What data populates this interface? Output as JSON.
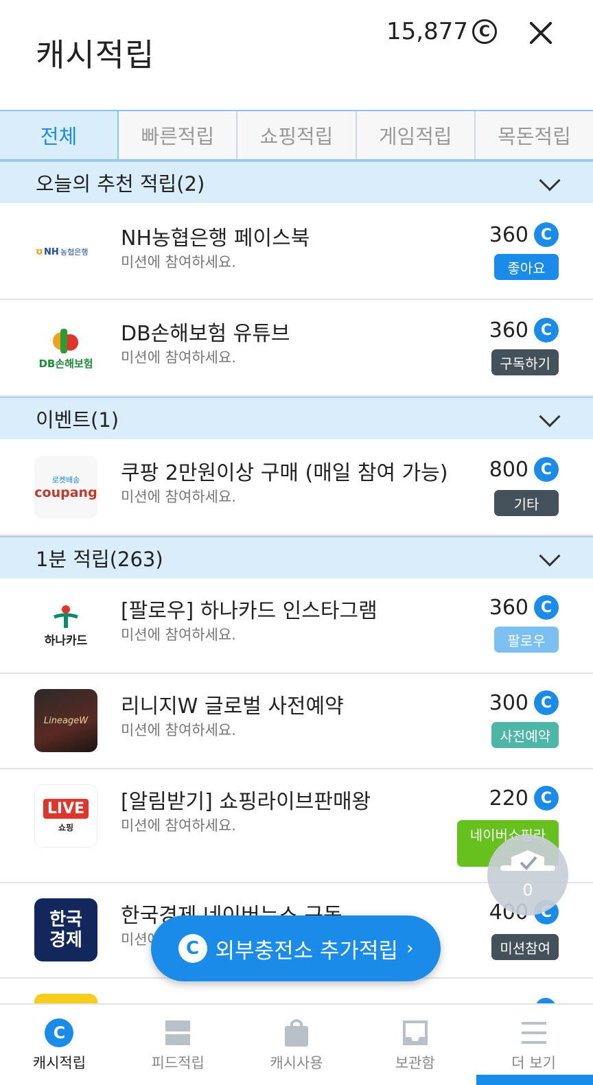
{
  "header": {
    "title": "캐시적립",
    "balance": "15,877",
    "balance_icon": "Ⓒ"
  },
  "tabs": [
    {
      "label": "전체",
      "active": true
    },
    {
      "label": "빠른적립",
      "active": false
    },
    {
      "label": "쇼핑적립",
      "active": false
    },
    {
      "label": "게임적립",
      "active": false
    },
    {
      "label": "목돈적립",
      "active": false
    }
  ],
  "sections": [
    {
      "title": "오늘의 추천 적립(2)"
    },
    {
      "title": "이벤트(1)"
    },
    {
      "title": "1분 적립(263)"
    }
  ],
  "items": [
    {
      "title": "NH농협은행 페이스북",
      "sub": "미션에 참여하세요.",
      "points": "360",
      "tag": "좋아요",
      "tag_color": "#1a8be8",
      "logo_text": "NH농협은행"
    },
    {
      "title": "DB손해보험 유튜브",
      "sub": "미션에 참여하세요.",
      "points": "360",
      "tag": "구독하기",
      "tag_color": "#44505a",
      "logo_text": "DB손해보험"
    },
    {
      "title": "쿠팡 2만원이상 구매 (매일 참여 가능)",
      "sub": "미션에 참여하세요.",
      "points": "800",
      "tag": "기타",
      "tag_color": "#44505a",
      "logo_text": "coupang",
      "logo_top": "로켓배송"
    },
    {
      "title": "[팔로우] 하나카드 인스타그램",
      "sub": "미션에 참여하세요.",
      "points": "360",
      "tag": "팔로우",
      "tag_color": "#7cc0f2",
      "logo_text": "하나카드"
    },
    {
      "title": "리니지W 글로벌  사전예약",
      "sub": "미션에 참여하세요.",
      "points": "300",
      "tag": "사전예약",
      "tag_color": "#4db6a6",
      "logo_text": "LineageW"
    },
    {
      "title": "[알림받기] 쇼핑라이브판매왕",
      "sub": "미션에 참여하세요.",
      "points": "220",
      "tag": "네이버쇼핑라",
      "tag_color": "#66c11e",
      "logo_text": "LIVE",
      "logo_sub": "쇼핑"
    },
    {
      "title": "한국경제 네이버뉴스 구독",
      "sub": "미션에 참여하세요.",
      "points": "400",
      "tag": "미션참여",
      "tag_color": "#44505a",
      "logo_text": "한국\n경제"
    }
  ],
  "float_button": {
    "label": "외부충전소 추가적립",
    "arrow": "›"
  },
  "badge": {
    "count": "0"
  },
  "bottom_nav": [
    {
      "label": "캐시적립",
      "icon": "cash-c-icon",
      "active": true
    },
    {
      "label": "피드적립",
      "icon": "feed-icon",
      "active": false
    },
    {
      "label": "캐시사용",
      "icon": "shopping-bag-icon",
      "active": false
    },
    {
      "label": "보관함",
      "icon": "inbox-icon",
      "active": false
    },
    {
      "label": "더 보기",
      "icon": "menu-icon",
      "active": false
    }
  ],
  "colors": {
    "accent": "#1a8be8",
    "section_bg": "#d9edfb"
  }
}
